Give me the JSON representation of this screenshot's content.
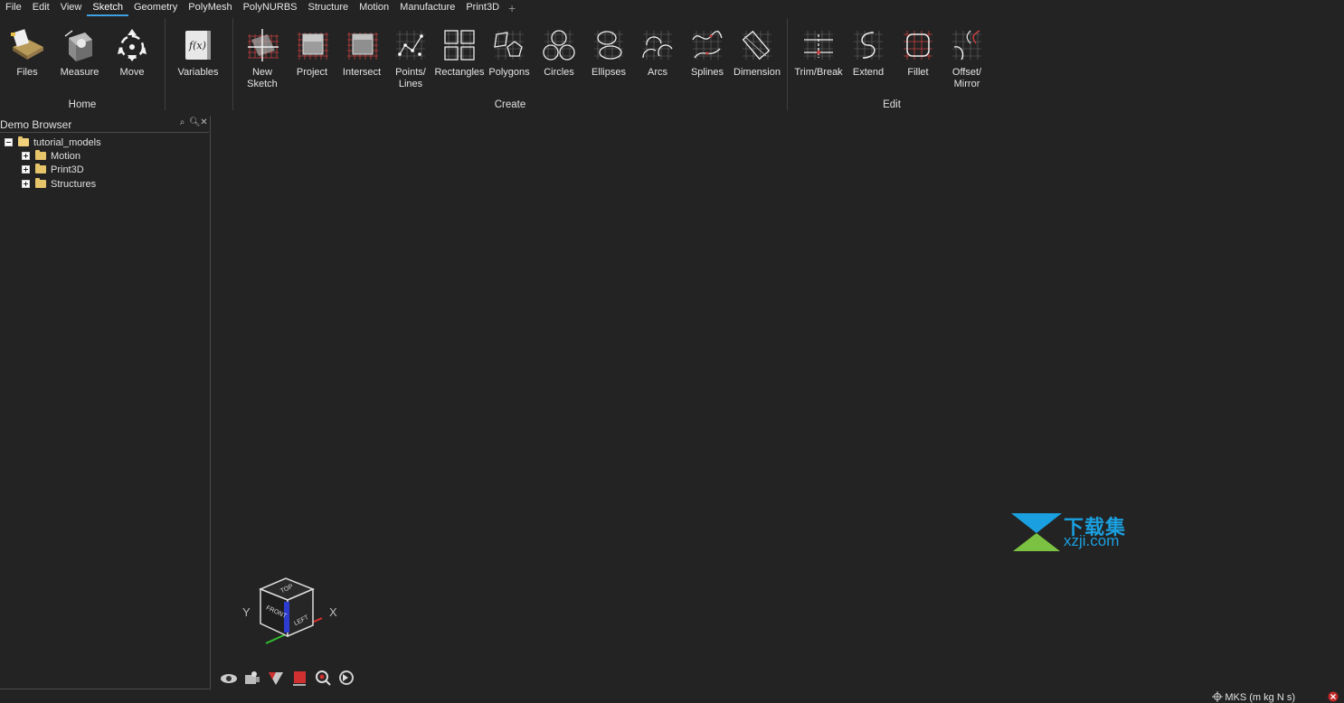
{
  "menu": {
    "items": [
      "File",
      "Edit",
      "View",
      "Sketch",
      "Geometry",
      "PolyMesh",
      "PolyNURBS",
      "Structure",
      "Motion",
      "Manufacture",
      "Print3D"
    ],
    "active": "Sketch",
    "add_tab": "+"
  },
  "ribbon": {
    "home": {
      "label": "Home",
      "tools": [
        "Files",
        "Measure",
        "Move"
      ]
    },
    "variables": {
      "tool": "Variables"
    },
    "create": {
      "label": "Create",
      "tools": [
        "New\nSketch",
        "Project",
        "Intersect",
        "Points/\nLines",
        "Rectangles",
        "Polygons",
        "Circles",
        "Ellipses",
        "Arcs",
        "Splines",
        "Dimension"
      ]
    },
    "edit": {
      "label": "Edit",
      "tools": [
        "Trim/Break",
        "Extend",
        "Fillet",
        "Offset/\nMirror"
      ]
    }
  },
  "browser": {
    "title": "Demo Browser",
    "root": "tutorial_models",
    "children": [
      "Motion",
      "Print3D",
      "Structures"
    ]
  },
  "viewcube": {
    "top": "TOP",
    "front": "FRONT",
    "left": "LEFT",
    "axis_y": "Y",
    "axis_x": "X"
  },
  "status": {
    "units": "MKS (m kg N s)"
  },
  "watermark": {
    "cn": "下载集",
    "en": "xzji.com"
  },
  "colors": {
    "background": "#232323",
    "accent": "#3fa0e0",
    "watermark": "#1aa0e0"
  }
}
